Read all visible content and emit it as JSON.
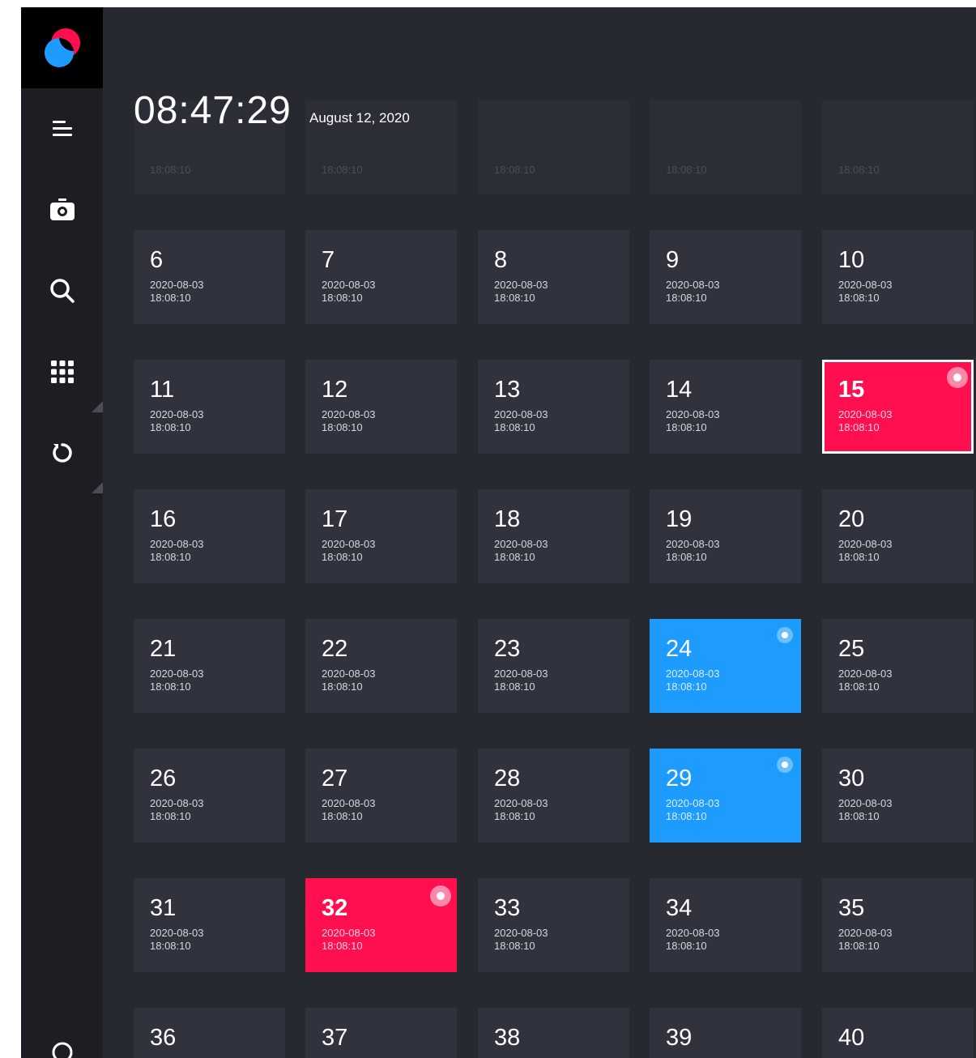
{
  "header": {
    "time": "08:47:29",
    "date": "August 12, 2020"
  },
  "sidebar": {
    "logo": "app-logo",
    "items": [
      {
        "name": "menu-icon"
      },
      {
        "name": "camera-icon"
      },
      {
        "name": "search-icon"
      },
      {
        "name": "grid-icon"
      },
      {
        "name": "refresh-icon"
      }
    ]
  },
  "colors": {
    "accent_red": "#ff0f50",
    "accent_blue": "#1e9bff",
    "tile": "#30333d"
  },
  "partial_row": [
    {
      "time": "18:08:10"
    },
    {
      "time": "18:08:10"
    },
    {
      "time": "18:08:10"
    },
    {
      "time": "18:08:10"
    },
    {
      "time": "18:08:10"
    }
  ],
  "tiles": [
    {
      "num": "6",
      "date": "2020-08-03",
      "time": "18:08:10",
      "state": "normal"
    },
    {
      "num": "7",
      "date": "2020-08-03",
      "time": "18:08:10",
      "state": "normal"
    },
    {
      "num": "8",
      "date": "2020-08-03",
      "time": "18:08:10",
      "state": "normal"
    },
    {
      "num": "9",
      "date": "2020-08-03",
      "time": "18:08:10",
      "state": "normal"
    },
    {
      "num": "10",
      "date": "2020-08-03",
      "time": "18:08:10",
      "state": "normal"
    },
    {
      "num": "11",
      "date": "2020-08-03",
      "time": "18:08:10",
      "state": "normal"
    },
    {
      "num": "12",
      "date": "2020-08-03",
      "time": "18:08:10",
      "state": "normal"
    },
    {
      "num": "13",
      "date": "2020-08-03",
      "time": "18:08:10",
      "state": "normal"
    },
    {
      "num": "14",
      "date": "2020-08-03",
      "time": "18:08:10",
      "state": "normal"
    },
    {
      "num": "15",
      "date": "2020-08-03",
      "time": "18:08:10",
      "state": "red-selected"
    },
    {
      "num": "16",
      "date": "2020-08-03",
      "time": "18:08:10",
      "state": "normal"
    },
    {
      "num": "17",
      "date": "2020-08-03",
      "time": "18:08:10",
      "state": "normal"
    },
    {
      "num": "18",
      "date": "2020-08-03",
      "time": "18:08:10",
      "state": "normal"
    },
    {
      "num": "19",
      "date": "2020-08-03",
      "time": "18:08:10",
      "state": "normal"
    },
    {
      "num": "20",
      "date": "2020-08-03",
      "time": "18:08:10",
      "state": "normal"
    },
    {
      "num": "21",
      "date": "2020-08-03",
      "time": "18:08:10",
      "state": "normal"
    },
    {
      "num": "22",
      "date": "2020-08-03",
      "time": "18:08:10",
      "state": "normal"
    },
    {
      "num": "23",
      "date": "2020-08-03",
      "time": "18:08:10",
      "state": "normal"
    },
    {
      "num": "24",
      "date": "2020-08-03",
      "time": "18:08:10",
      "state": "blue"
    },
    {
      "num": "25",
      "date": "2020-08-03",
      "time": "18:08:10",
      "state": "normal"
    },
    {
      "num": "26",
      "date": "2020-08-03",
      "time": "18:08:10",
      "state": "normal"
    },
    {
      "num": "27",
      "date": "2020-08-03",
      "time": "18:08:10",
      "state": "normal"
    },
    {
      "num": "28",
      "date": "2020-08-03",
      "time": "18:08:10",
      "state": "normal"
    },
    {
      "num": "29",
      "date": "2020-08-03",
      "time": "18:08:10",
      "state": "blue"
    },
    {
      "num": "30",
      "date": "2020-08-03",
      "time": "18:08:10",
      "state": "normal"
    },
    {
      "num": "31",
      "date": "2020-08-03",
      "time": "18:08:10",
      "state": "normal"
    },
    {
      "num": "32",
      "date": "2020-08-03",
      "time": "18:08:10",
      "state": "red"
    },
    {
      "num": "33",
      "date": "2020-08-03",
      "time": "18:08:10",
      "state": "normal"
    },
    {
      "num": "34",
      "date": "2020-08-03",
      "time": "18:08:10",
      "state": "normal"
    },
    {
      "num": "35",
      "date": "2020-08-03",
      "time": "18:08:10",
      "state": "normal"
    },
    {
      "num": "36",
      "date": "",
      "time": "",
      "state": "normal"
    },
    {
      "num": "37",
      "date": "",
      "time": "",
      "state": "normal"
    },
    {
      "num": "38",
      "date": "",
      "time": "",
      "state": "normal"
    },
    {
      "num": "39",
      "date": "",
      "time": "",
      "state": "normal"
    },
    {
      "num": "40",
      "date": "",
      "time": "",
      "state": "normal"
    }
  ]
}
